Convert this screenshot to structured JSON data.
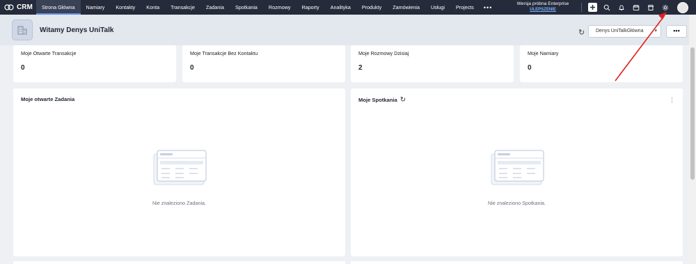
{
  "app": {
    "name": "CRM"
  },
  "nav": {
    "items": [
      {
        "label": "Strona Główna",
        "active": true
      },
      {
        "label": "Namiary"
      },
      {
        "label": "Kontakty"
      },
      {
        "label": "Konta"
      },
      {
        "label": "Transakcje"
      },
      {
        "label": "Zadania"
      },
      {
        "label": "Spotkania"
      },
      {
        "label": "Rozmowy"
      },
      {
        "label": "Raporty"
      },
      {
        "label": "Analityka"
      },
      {
        "label": "Produkty"
      },
      {
        "label": "Zamówienia"
      },
      {
        "label": "Usługi"
      },
      {
        "label": "Projects"
      }
    ],
    "more": "•••",
    "trial_text": "Wersja próbna Enterprise",
    "upgrade_link": "ULEPSZENIE",
    "icons": [
      "plus-icon",
      "search-icon",
      "bell-icon",
      "calendar-icon",
      "marketplace-icon",
      "gear-icon",
      "avatar"
    ]
  },
  "header": {
    "welcome": "Witamy Denys UniTalk",
    "dashboard_select": "Denys UniTalkGłówna",
    "more_label": "•••"
  },
  "kpis": [
    {
      "label": "Moje Otwarte Transakcje",
      "value": "0"
    },
    {
      "label": "Moje Transakcje Bez Kontaktu",
      "value": "0"
    },
    {
      "label": "Moje Rozmowy Dzisiaj",
      "value": "2"
    },
    {
      "label": "Moje Namiary",
      "value": "0"
    }
  ],
  "panels": {
    "tasks": {
      "title": "Moje otwarte Zadania",
      "empty": "Nie znaleziono Zadania."
    },
    "meetings": {
      "title": "Moje Spotkania",
      "empty": "Nie znaleziono Spotkania."
    }
  },
  "colors": {
    "nav_bg": "#252b3a",
    "accent": "#5b8def",
    "annotation_arrow": "#e02020",
    "page_bg": "#eef0f4"
  }
}
